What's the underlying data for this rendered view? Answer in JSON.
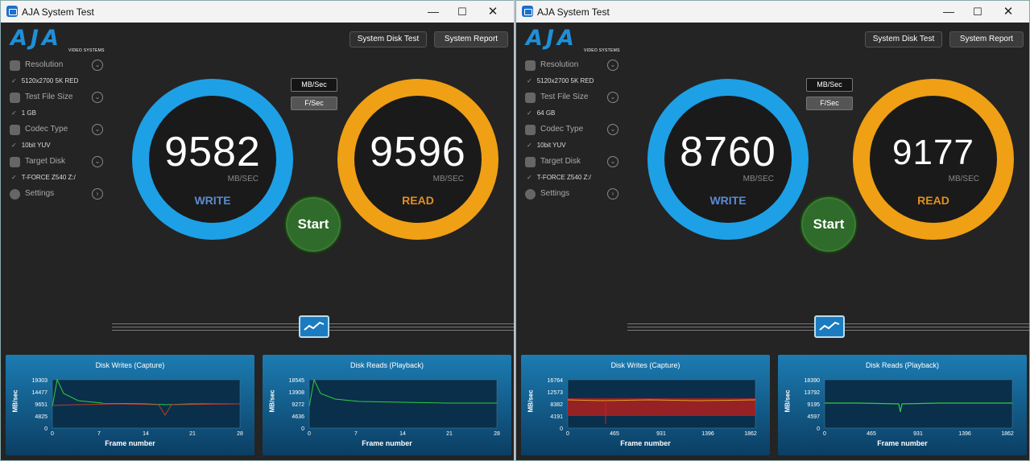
{
  "app": {
    "title": "AJA System Test",
    "logo_text": "AJA",
    "logo_sub": "VIDEO SYSTEMS"
  },
  "toolbar": {
    "disk_test": "System Disk Test",
    "report": "System Report",
    "mb_sec": "MB/Sec",
    "f_sec": "F/Sec"
  },
  "side": {
    "resolution": "Resolution",
    "file_size": "Test File Size",
    "codec": "Codec Type",
    "target": "Target Disk",
    "settings": "Settings"
  },
  "windows": [
    {
      "resolution_val": "5120x2700 5K RED",
      "file_size_val": "1 GB",
      "codec_val": "10bit YUV",
      "target_val": "T-FORCE Z540 Z:/",
      "write": "9582",
      "read": "9596",
      "unit": "MB/SEC",
      "write_label": "WRITE",
      "read_label": "READ",
      "start": "Start",
      "charts": [
        {
          "title": "Disk Writes (Capture)",
          "yticks": [
            "19303",
            "14477",
            "9651",
            "4825",
            "0"
          ],
          "xticks": [
            "0",
            "7",
            "14",
            "21",
            "28"
          ],
          "xlabel": "Frame number",
          "ylabel": "MB/sec"
        },
        {
          "title": "Disk Reads (Playback)",
          "yticks": [
            "18545",
            "13908",
            "9272",
            "4636",
            "0"
          ],
          "xticks": [
            "0",
            "7",
            "14",
            "21",
            "28"
          ],
          "xlabel": "Frame number",
          "ylabel": "MB/sec"
        }
      ]
    },
    {
      "resolution_val": "5120x2700 5K RED",
      "file_size_val": "64 GB",
      "codec_val": "10bit YUV",
      "target_val": "T-FORCE Z540 Z:/",
      "write": "8760",
      "read": "9177",
      "unit": "MB/SEC",
      "write_label": "WRITE",
      "read_label": "READ",
      "start": "Start",
      "charts": [
        {
          "title": "Disk Writes (Capture)",
          "yticks": [
            "16764",
            "12573",
            "8382",
            "4191",
            "0"
          ],
          "xticks": [
            "0",
            "465",
            "931",
            "1396",
            "1862"
          ],
          "xlabel": "Frame number",
          "ylabel": "MB/sec"
        },
        {
          "title": "Disk Reads (Playback)",
          "yticks": [
            "18390",
            "13792",
            "9195",
            "4597",
            "0"
          ],
          "xticks": [
            "0",
            "465",
            "931",
            "1396",
            "1862"
          ],
          "xlabel": "Frame number",
          "ylabel": "MB/sec"
        }
      ]
    }
  ],
  "colors": {
    "write": "#1ea0e6",
    "read": "#f0a015",
    "start": "#2f6b2a"
  }
}
